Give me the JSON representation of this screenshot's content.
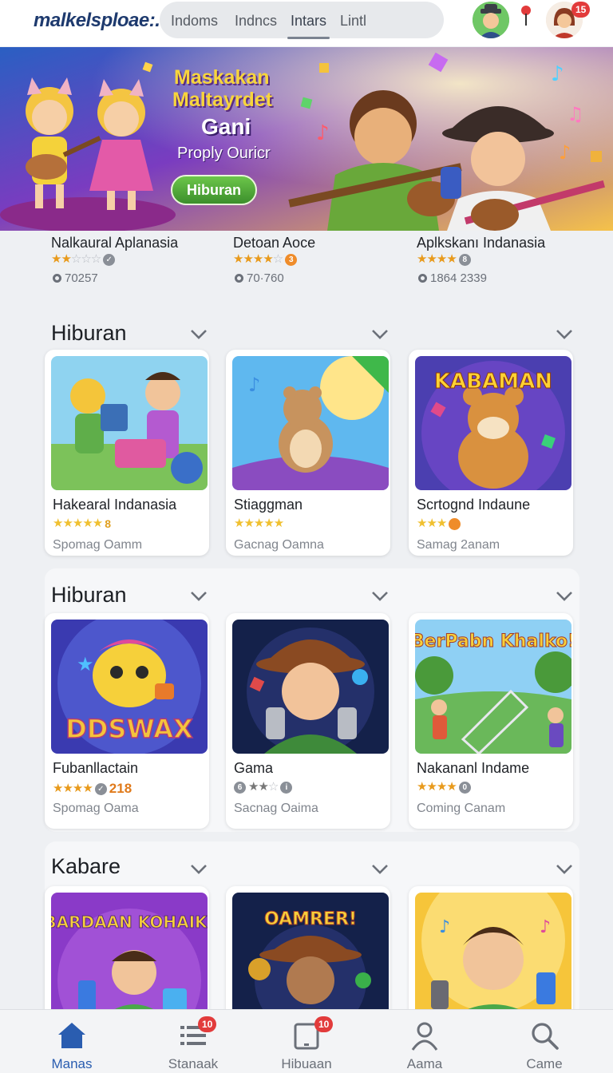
{
  "header": {
    "logo": "malkelsploae:.",
    "tabs": [
      "Indoms",
      "Indncs",
      "Intars",
      "Lintl"
    ],
    "active_tab": "Intars",
    "avatar_badge": "15"
  },
  "hero": {
    "title_line1": "Maskakan",
    "title_line2": "Maltayrdet",
    "subtitle": "Gani",
    "tagline": "Proply Ouricr",
    "button": "Hiburan"
  },
  "featured": [
    {
      "name": "Nalkaural Aplanasia",
      "stars": 2,
      "coin": "✓",
      "count": "70257"
    },
    {
      "name": "Detoan Aoce",
      "stars": 4,
      "coin": "3",
      "count": "70·760"
    },
    {
      "name": "Aplkskanı Indanasia",
      "stars": 4,
      "coin": "8",
      "count": "1864 2339"
    }
  ],
  "sections": [
    {
      "title": "Hiburan",
      "cards": [
        {
          "name": "Hakearal Indanasia",
          "stars": 5,
          "extra": "8",
          "sub": "Spomag Oamm"
        },
        {
          "name": "Stiaggman",
          "stars": 5,
          "extra": "",
          "sub": "Gacnag Oamna"
        },
        {
          "name": "Scrtognd Indaune",
          "stars": 3,
          "extra": "",
          "sub": "Samag 2anam"
        }
      ]
    },
    {
      "title": "Hiburan",
      "cards": [
        {
          "name": "Fubanllactain",
          "stars": 4,
          "extra": "218",
          "sub": "Spomag Oama"
        },
        {
          "name": "Gama",
          "stars": 3,
          "extra": "",
          "sub": "Sacnag Oaima"
        },
        {
          "name": "Nakananl Indame",
          "stars": 4,
          "extra": "",
          "sub": "Coming Canam"
        }
      ]
    },
    {
      "title": "Kabare",
      "cards": [
        {
          "art_text": "BARDAAN KOHAIK!"
        },
        {
          "art_text": "OAMRER!"
        },
        {
          "art_text": ""
        }
      ]
    }
  ],
  "art": {
    "card3": "KABAMAN",
    "card4": "DDSWAX",
    "card6": "BerPabn Khalko!"
  },
  "tabbar": {
    "items": [
      "Manas",
      "Stanaak",
      "Hibuaan",
      "Aama",
      "Came"
    ],
    "active": "Manas",
    "badge_1": "10",
    "badge_2": "10"
  },
  "colors": {
    "brand": "#1e3a6e",
    "accent": "#2a5db0",
    "star": "#e89a1c",
    "badge": "#e23b3b"
  }
}
